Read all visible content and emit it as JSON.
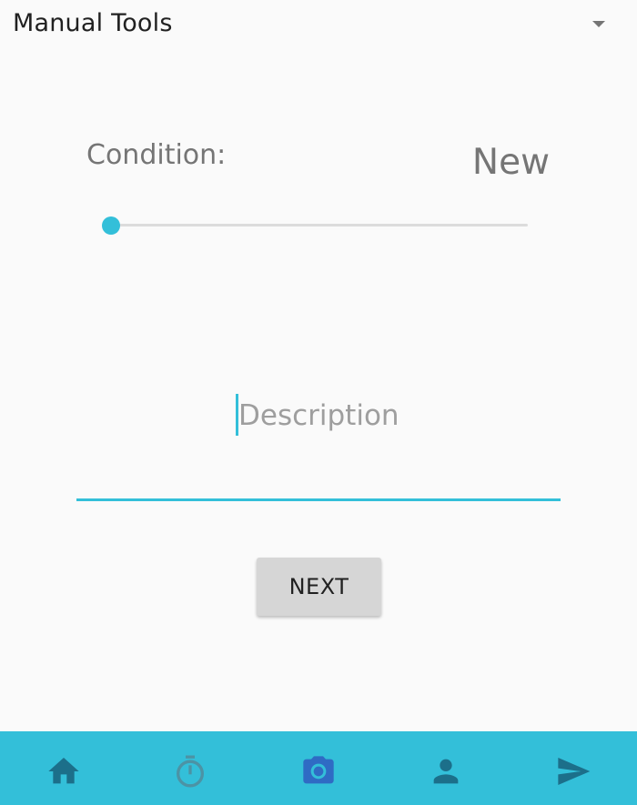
{
  "category": {
    "value": "Manual Tools",
    "dropdown_icon": "chevron-down-icon"
  },
  "condition": {
    "label": "Condition:",
    "value": "New",
    "slider_level": 0
  },
  "description": {
    "placeholder": "Description",
    "value": ""
  },
  "next_button": {
    "label": "NEXT"
  },
  "bottom_nav": {
    "items": [
      {
        "icon": "home-icon",
        "active": false
      },
      {
        "icon": "timer-icon",
        "active": false
      },
      {
        "icon": "camera-icon",
        "active": true
      },
      {
        "icon": "person-icon",
        "active": false
      },
      {
        "icon": "send-icon",
        "active": false
      }
    ]
  },
  "colors": {
    "accent": "#33bfd9",
    "nav_icon": "#1c6f8a",
    "nav_icon_inactive": "#4c93a5",
    "nav_icon_active": "#2f6bc4",
    "button_bg": "#d6d6d6",
    "background": "#fafafa"
  }
}
